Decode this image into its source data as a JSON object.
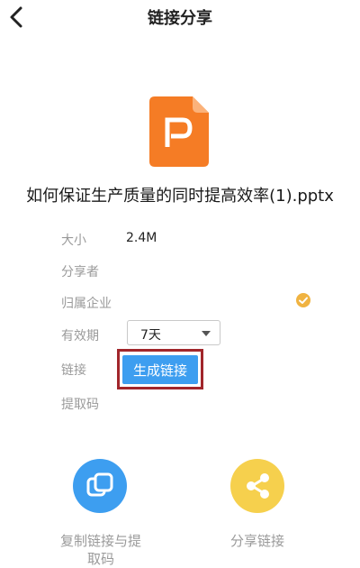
{
  "header": {
    "title": "链接分享"
  },
  "file": {
    "name": "如何保证生产质量的同时提高效率(1).pptx",
    "icon": "ppt-file-icon",
    "icon_color": "#f57c25"
  },
  "details": {
    "size_label": "大小",
    "size_value": "2.4M",
    "sharer_label": "分享者",
    "enterprise_label": "归属企业",
    "validity_label": "有效期",
    "validity_value": "7天",
    "link_label": "链接",
    "generate_button": "生成链接",
    "code_label": "提取码"
  },
  "actions": {
    "copy_label": "复制链接与提取码",
    "share_label": "分享链接"
  },
  "colors": {
    "accent_blue": "#3d9ef0",
    "share_yellow": "#f6d04d",
    "highlight_red": "#a1262b",
    "badge_orange": "#f0b341"
  }
}
